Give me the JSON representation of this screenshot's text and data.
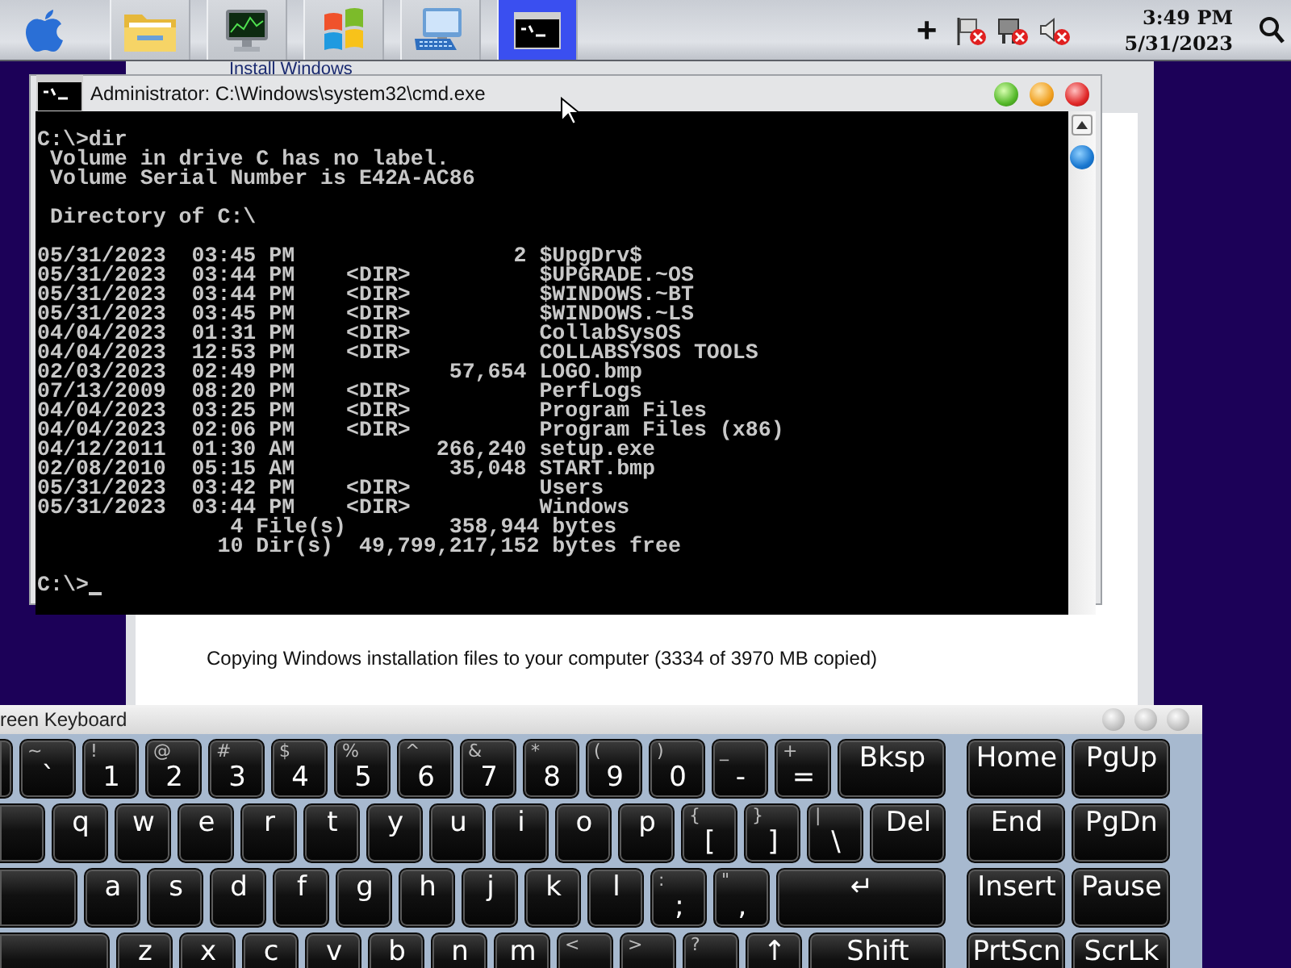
{
  "taskbar": {
    "items": [
      {
        "kind": "folder",
        "selected": false
      },
      {
        "kind": "monitor",
        "selected": false
      },
      {
        "kind": "flag",
        "selected": false
      },
      {
        "kind": "keyboard",
        "selected": false
      },
      {
        "kind": "terminal",
        "selected": true
      }
    ],
    "tray": {
      "add": "+",
      "icons": [
        {
          "kind": "flag-error"
        },
        {
          "kind": "network-error"
        },
        {
          "kind": "speaker-mute"
        }
      ],
      "time": "3:49 PM",
      "date": "5/31/2023"
    }
  },
  "install_window": {
    "title": "Install Windows",
    "status": "Copying Windows installation files to your computer (3334 of 3970 MB copied)"
  },
  "cmd_window": {
    "title": "Administrator: C:\\Windows\\system32\\cmd.exe",
    "console": [
      [
        "C:\\>dir",
        " Volume in drive C has no label.",
        " Volume Serial Number is E42A-AC86"
      ],
      [
        " Directory of C:\\"
      ],
      [
        "05/31/2023  03:45 PM                 2 $UpgDrv$",
        "05/31/2023  03:44 PM    <DIR>          $UPGRADE.~OS",
        "05/31/2023  03:44 PM    <DIR>          $WINDOWS.~BT",
        "05/31/2023  03:45 PM    <DIR>          $WINDOWS.~LS",
        "04/04/2023  01:31 PM    <DIR>          CollabSysOS",
        "04/04/2023  12:53 PM    <DIR>          COLLABSYSOS TOOLS",
        "02/03/2023  02:49 PM            57,654 LOGO.bmp",
        "07/13/2009  08:20 PM    <DIR>          PerfLogs",
        "04/04/2023  03:25 PM    <DIR>          Program Files",
        "04/04/2023  02:06 PM    <DIR>          Program Files (x86)",
        "04/12/2011  01:30 AM           266,240 setup.exe",
        "02/08/2010  05:15 AM            35,048 START.bmp",
        "05/31/2023  03:42 PM    <DIR>          Users",
        "05/31/2023  03:44 PM    <DIR>          Windows",
        "               4 File(s)        358,944 bytes",
        "              10 Dir(s)  49,799,217,152 bytes free"
      ],
      [
        "C:\\>"
      ]
    ]
  },
  "keyboard": {
    "title": "reen Keyboard",
    "rows": [
      {
        "main": [
          {
            "shift": "~",
            "label": "`"
          },
          {
            "shift": "!",
            "label": "1"
          },
          {
            "shift": "@",
            "label": "2"
          },
          {
            "shift": "#",
            "label": "3"
          },
          {
            "shift": "$",
            "label": "4"
          },
          {
            "shift": "%",
            "label": "5"
          },
          {
            "shift": "^",
            "label": "6"
          },
          {
            "shift": "&",
            "label": "7"
          },
          {
            "shift": "*",
            "label": "8"
          },
          {
            "shift": "(",
            "label": "9"
          },
          {
            "shift": ")",
            "label": "0"
          },
          {
            "shift": "_",
            "label": "-"
          },
          {
            "shift": "+",
            "label": "="
          },
          {
            "label": "Bksp"
          }
        ],
        "nav": [
          {
            "label": "Home"
          },
          {
            "label": "PgUp"
          }
        ]
      },
      {
        "main": [
          {
            "label": "q"
          },
          {
            "label": "w"
          },
          {
            "label": "e"
          },
          {
            "label": "r"
          },
          {
            "label": "t"
          },
          {
            "label": "y"
          },
          {
            "label": "u"
          },
          {
            "label": "i"
          },
          {
            "label": "o"
          },
          {
            "label": "p"
          },
          {
            "shift": "{",
            "label": "["
          },
          {
            "shift": "}",
            "label": "]"
          },
          {
            "shift": "|",
            "label": "\\"
          },
          {
            "label": "Del"
          }
        ],
        "nav": [
          {
            "label": "End"
          },
          {
            "label": "PgDn"
          }
        ]
      },
      {
        "main": [
          {
            "label": "a"
          },
          {
            "label": "s"
          },
          {
            "label": "d"
          },
          {
            "label": "f"
          },
          {
            "label": "g"
          },
          {
            "label": "h"
          },
          {
            "label": "j"
          },
          {
            "label": "k"
          },
          {
            "label": "l"
          },
          {
            "shift": ":",
            "label": ";"
          },
          {
            "shift": "\"",
            "label": ","
          },
          {
            "label": "↵"
          }
        ],
        "nav": [
          {
            "label": "Insert"
          },
          {
            "label": "Pause"
          }
        ]
      },
      {
        "main": [
          {
            "label": "z"
          },
          {
            "label": "x"
          },
          {
            "label": "c"
          },
          {
            "label": "v"
          },
          {
            "label": "b"
          },
          {
            "label": "n"
          },
          {
            "label": "m"
          },
          {
            "shift": "<"
          },
          {
            "shift": ">"
          },
          {
            "shift": "?"
          },
          {
            "label": "↑"
          },
          {
            "label": "Shift"
          }
        ],
        "nav": [
          {
            "label": "PrtScn"
          },
          {
            "label": "ScrLk"
          }
        ]
      }
    ]
  }
}
